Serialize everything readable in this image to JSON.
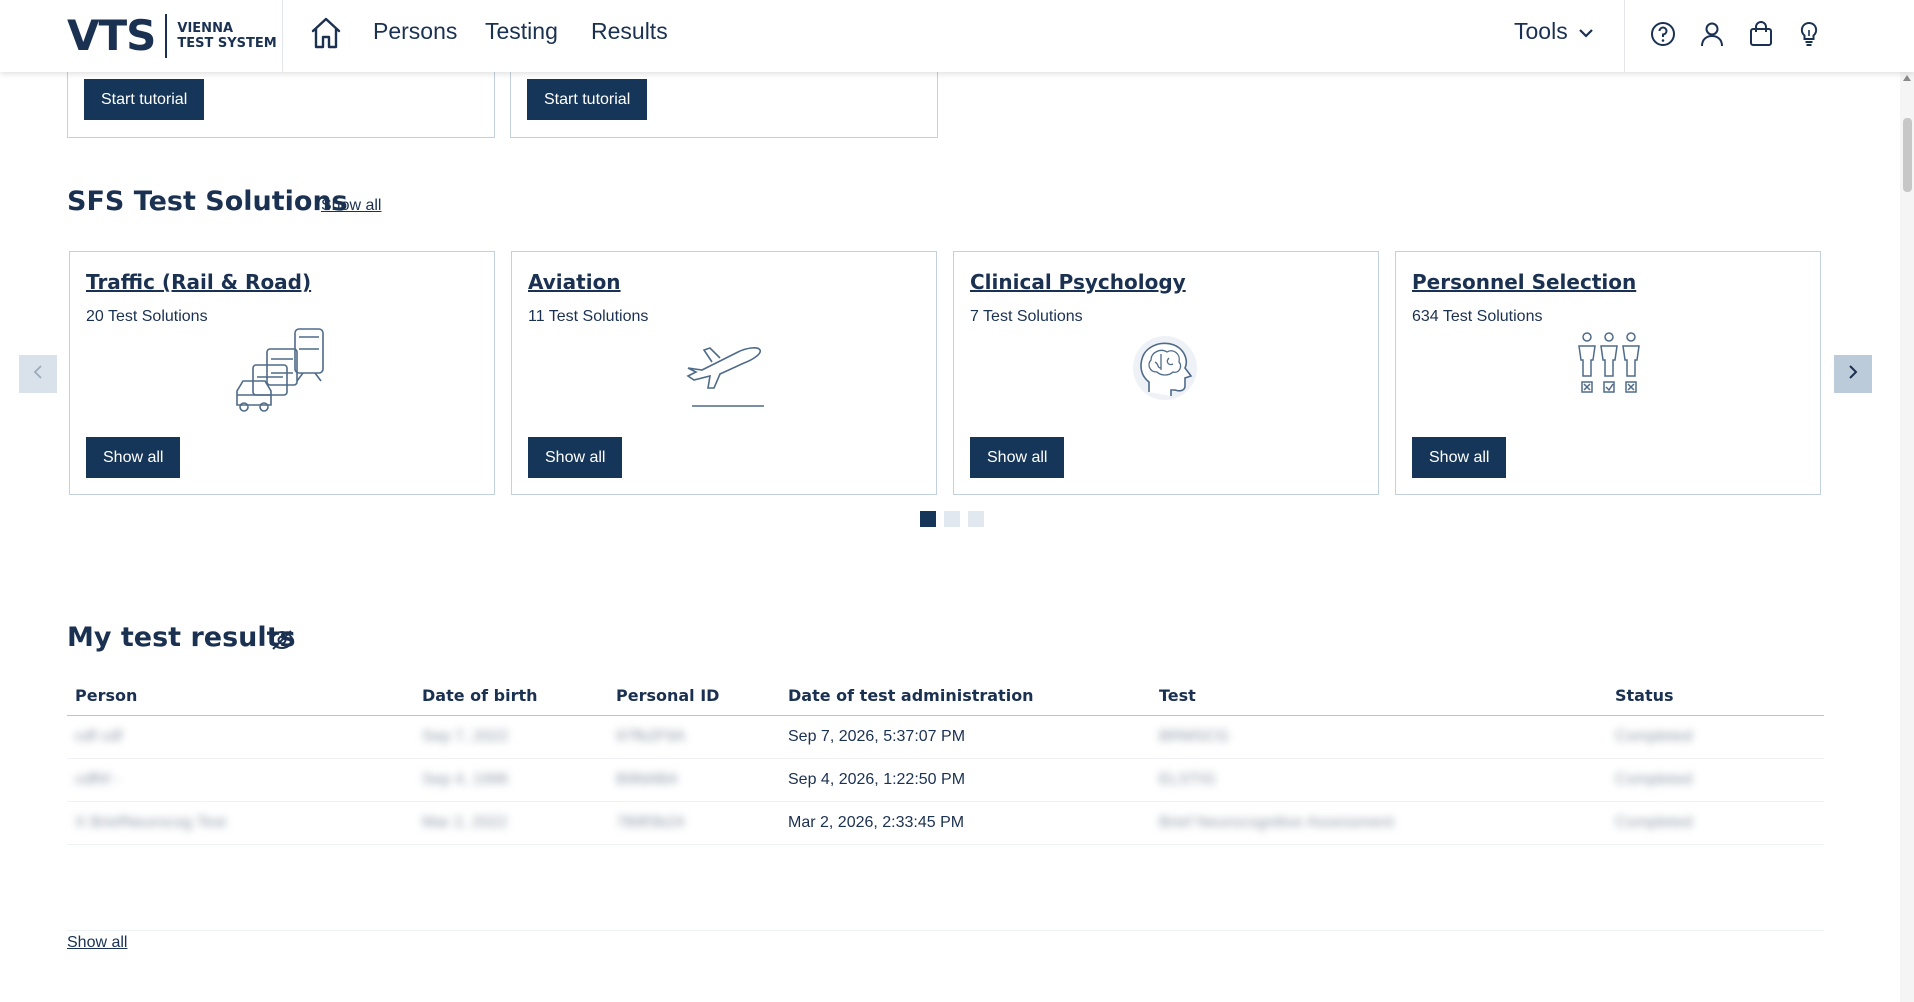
{
  "header": {
    "logo_text": "VTS",
    "logo_sub_line1": "VIENNA",
    "logo_sub_line2": "TEST SYSTEM",
    "nav": [
      "Persons",
      "Testing",
      "Results"
    ],
    "tools_label": "Tools",
    "icons": [
      "home-icon",
      "help-icon",
      "user-icon",
      "shopping-bag-icon",
      "lightbulb-icon",
      "chevron-down-icon"
    ]
  },
  "tutorials": {
    "button_label_1": "Start tutorial",
    "button_label_2": "Start tutorial"
  },
  "solutions": {
    "title": "SFS Test Solutions",
    "show_all_link": "Show all",
    "cards": [
      {
        "title": "Traffic (Rail & Road)",
        "count": "20 Test Solutions",
        "button": "Show all",
        "icon": "traffic-vehicles-icon"
      },
      {
        "title": "Aviation",
        "count": "11 Test Solutions",
        "button": "Show all",
        "icon": "airplane-icon"
      },
      {
        "title": "Clinical Psychology",
        "count": "7 Test Solutions",
        "button": "Show all",
        "icon": "brain-head-icon"
      },
      {
        "title": "Personnel Selection",
        "count": "634 Test Solutions",
        "button": "Show all",
        "icon": "people-selection-icon"
      }
    ],
    "carousel": {
      "pages": 3,
      "active_page": 1
    }
  },
  "results": {
    "title": "My test results",
    "columns": [
      "Person",
      "Date of birth",
      "Personal ID",
      "Date of test administration",
      "Test",
      "Status"
    ],
    "rows": [
      {
        "person": "cdf cdf",
        "dob": "Sep 7, 2022",
        "pid": "97fb2F9A",
        "date": "Sep 7, 2026, 5:37:07 PM",
        "test": "BRMSCG",
        "status": "Completed"
      },
      {
        "person": "cdfhf -",
        "dob": "Sep 4, 1996",
        "pid": "B9fd4B4",
        "date": "Sep 4, 2026, 1:22:50 PM",
        "test": "ELSTIG",
        "status": "Completed"
      },
      {
        "person": "X  BriefNeurocog Test",
        "dob": "Mar 2, 2022",
        "pid": "7B8f3b24",
        "date": "Mar 2, 2026, 2:33:45 PM",
        "test": "Brief Neurocognitive Assessment",
        "status": "Completed"
      }
    ],
    "show_all_link": "Show all"
  }
}
